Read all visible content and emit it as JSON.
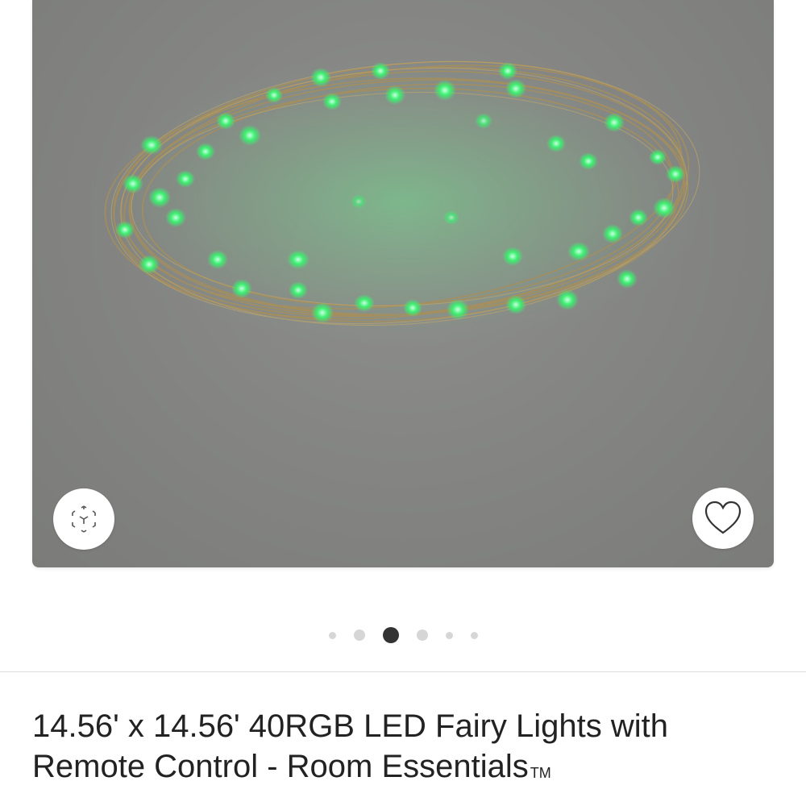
{
  "hero": {
    "image_alt": "Green LED fairy lights coiled on gray background",
    "ar_button_icon": "3d-view-icon",
    "favorite_button_icon": "heart-icon",
    "background_color": "#858684",
    "led_color": "#3cf070"
  },
  "carousel": {
    "total_slides": 6,
    "active_index": 2
  },
  "product": {
    "title": "14.56' x 14.56' 40RGB LED Fairy Lights with Remote Control - Room Essentials",
    "trademark": "TM"
  }
}
